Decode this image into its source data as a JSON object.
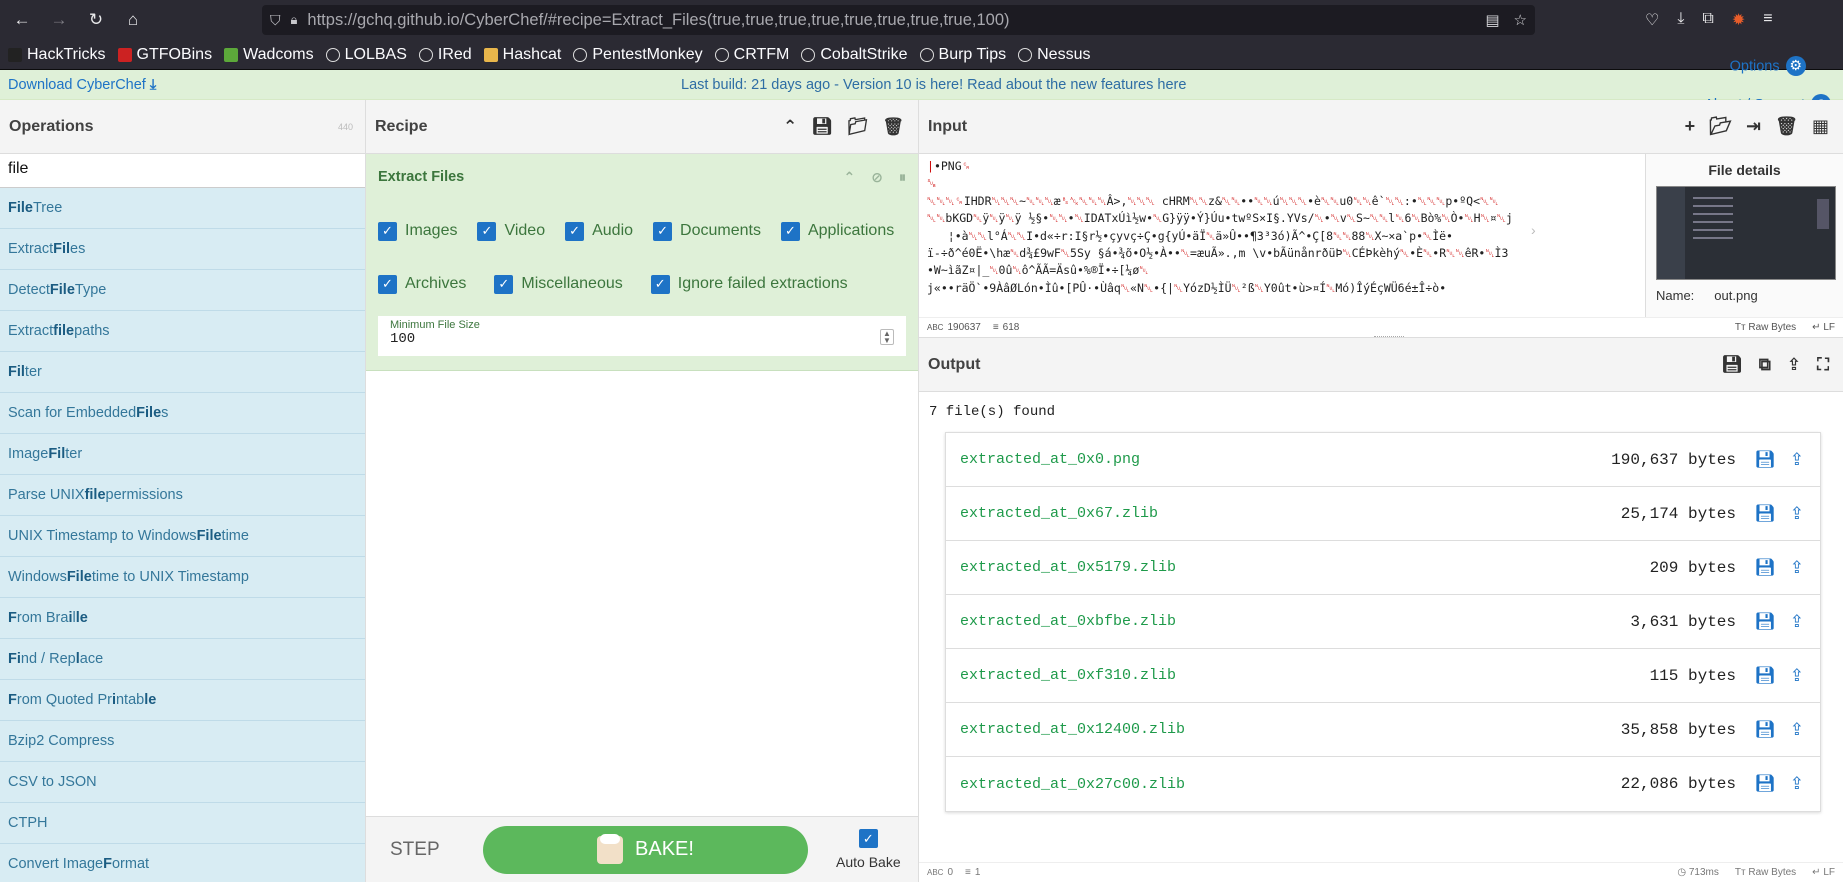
{
  "browser": {
    "url_host": "https://gchq.github.io",
    "url_path": "/CyberChef/#recipe=Extract_Files(true,true,true,true,true,true,true,true,100)"
  },
  "bookmarks": [
    {
      "label": "HackTricks",
      "color": "#222222"
    },
    {
      "label": "GTFOBins",
      "color": "#cc2222"
    },
    {
      "label": "Wadcoms",
      "color": "#5ca83a"
    },
    {
      "label": "LOLBAS",
      "color": "#dddddd"
    },
    {
      "label": "IRed",
      "color": "#dddddd"
    },
    {
      "label": "Hashcat",
      "color": "#e8b64b"
    },
    {
      "label": "PentestMonkey",
      "color": "#dddddd"
    },
    {
      "label": "CRTFM",
      "color": "#dddddd"
    },
    {
      "label": "CobaltStrike",
      "color": "#dddddd"
    },
    {
      "label": "Burp Tips",
      "color": "#dddddd"
    },
    {
      "label": "Nessus",
      "color": "#dddddd"
    }
  ],
  "banner": {
    "download": "Download CyberChef",
    "build_text": "Last build: 21 days ago - Version 10 is here! Read about the new features here",
    "options": "Options",
    "about": "About / Support"
  },
  "operations": {
    "title": "Operations",
    "count": "440",
    "search_value": "file",
    "items": [
      [
        "",
        "File",
        " Tree"
      ],
      [
        "Extract ",
        "Fil",
        "es"
      ],
      [
        "Detect ",
        "File",
        " Type"
      ],
      [
        "Extract ",
        "file",
        " paths"
      ],
      [
        "",
        "Fil",
        "ter"
      ],
      [
        "Scan for Embedded ",
        "File",
        "s"
      ],
      [
        "Image ",
        "Fil",
        "ter"
      ],
      [
        "Parse UNIX ",
        "file",
        " permissions"
      ],
      [
        "UNIX Timestamp to Windows ",
        "File",
        "time"
      ],
      [
        "Windows ",
        "File",
        "time to UNIX Timestamp"
      ],
      [
        "",
        "F",
        "rom Bra",
        "i",
        "l",
        "le"
      ],
      [
        "",
        "Fi",
        "nd / Rep",
        "l",
        "ace"
      ],
      [
        "",
        "F",
        "rom Quoted Pr",
        "i",
        "ntab",
        "le"
      ],
      [
        "Bzip2 Compress"
      ],
      [
        "CSV to JSON"
      ],
      [
        "CTPH"
      ],
      [
        "Convert Image ",
        "F",
        "ormat"
      ]
    ]
  },
  "recipe": {
    "title": "Recipe",
    "op_name": "Extract Files",
    "checks_row1": [
      "Images",
      "Video",
      "Audio",
      "Documents",
      "Applications"
    ],
    "checks_row2": [
      "Archives",
      "Miscellaneous",
      "Ignore failed extractions"
    ],
    "min_size_label": "Minimum File Size",
    "min_size_value": "100",
    "step": "STEP",
    "bake": "BAKE!",
    "auto_bake": "Auto Bake"
  },
  "input": {
    "title": "Input",
    "status_chars": "190637",
    "status_lines": "618",
    "raw_bytes": "Raw Bytes",
    "eol": "LF",
    "file_details_title": "File details",
    "name_label": "Name:",
    "name_value": "out.png"
  },
  "output": {
    "title": "Output",
    "summary": "7 file(s) found",
    "files": [
      {
        "name": "extracted_at_0x0.png",
        "size": "190,637 bytes"
      },
      {
        "name": "extracted_at_0x67.zlib",
        "size": "25,174 bytes"
      },
      {
        "name": "extracted_at_0x5179.zlib",
        "size": "209 bytes"
      },
      {
        "name": "extracted_at_0xbfbe.zlib",
        "size": "3,631 bytes"
      },
      {
        "name": "extracted_at_0xf310.zlib",
        "size": "115 bytes"
      },
      {
        "name": "extracted_at_0x12400.zlib",
        "size": "35,858 bytes"
      },
      {
        "name": "extracted_at_0x27c00.zlib",
        "size": "22,086 bytes"
      }
    ],
    "status_chars": "0",
    "status_lines": "1",
    "time": "713ms",
    "raw_bytes": "Raw Bytes",
    "eol": "LF"
  }
}
